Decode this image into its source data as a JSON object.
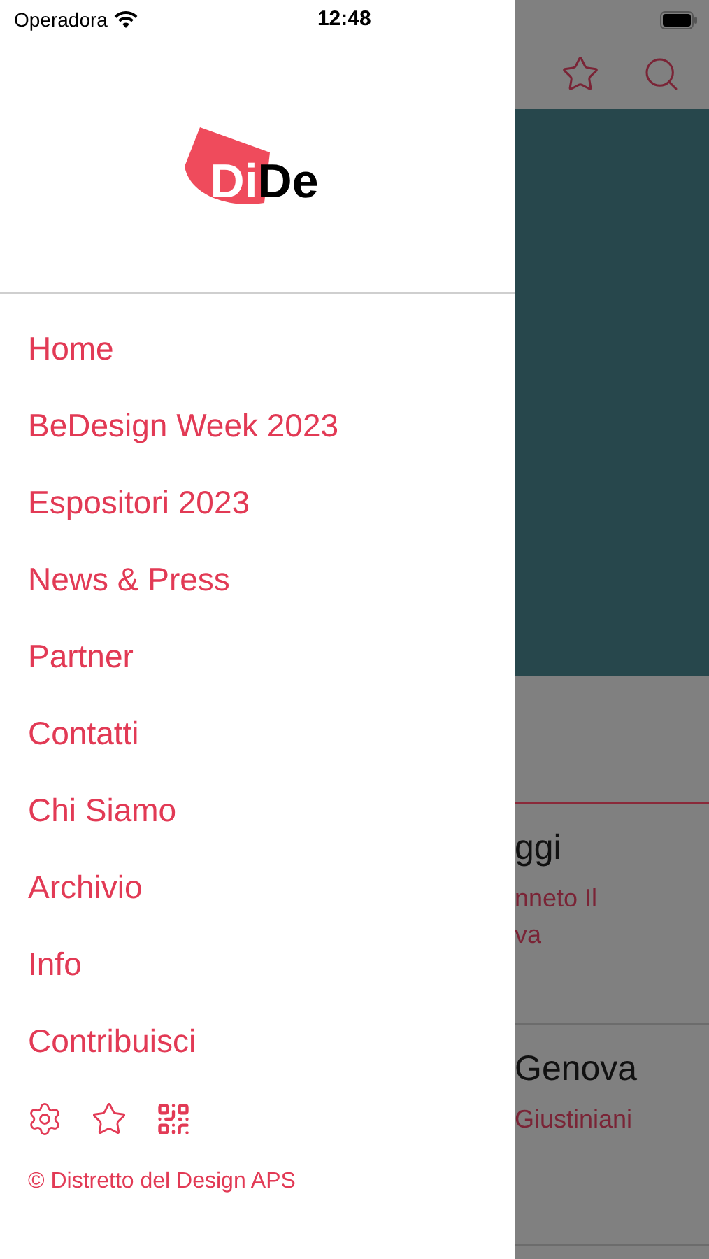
{
  "status_bar": {
    "carrier": "Operadora",
    "time": "12:48"
  },
  "drawer": {
    "logo": {
      "part_1": "Di",
      "part_2": "De"
    },
    "menu": [
      {
        "label": "Home"
      },
      {
        "label": "BeDesign Week 2023"
      },
      {
        "label": "Espositori 2023"
      },
      {
        "label": "News & Press"
      },
      {
        "label": "Partner"
      },
      {
        "label": "Contatti"
      },
      {
        "label": "Chi Siamo"
      },
      {
        "label": "Archivio"
      },
      {
        "label": "Info"
      },
      {
        "label": "Contribuisci"
      }
    ],
    "footer_icons": [
      {
        "kind": "settings"
      },
      {
        "kind": "favorites"
      },
      {
        "kind": "qr"
      }
    ],
    "copyright": "© Distretto del Design APS"
  },
  "background": {
    "cards": [
      {
        "title": "ggi",
        "lines": [
          "nneto Il",
          "va"
        ]
      },
      {
        "title": "Genova",
        "lines": [
          "Giustiniani"
        ]
      }
    ]
  }
}
